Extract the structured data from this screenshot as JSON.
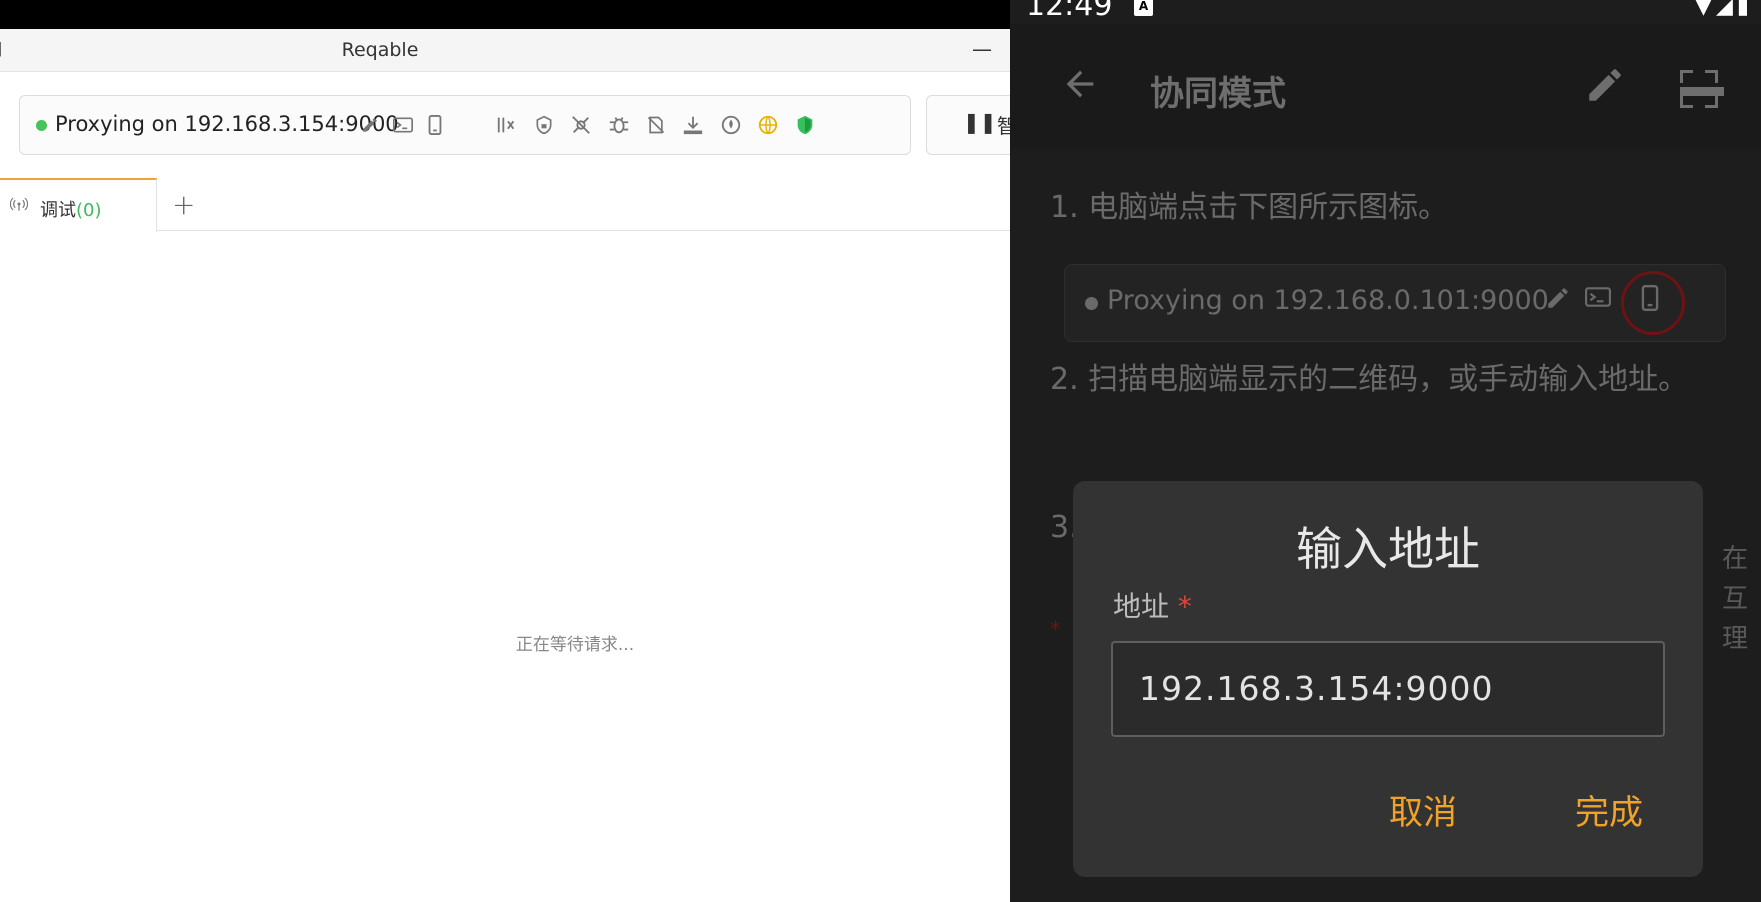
{
  "desktop": {
    "window_title": "Reqable",
    "minimize_glyph": "—",
    "edge_glyph": "]",
    "proxy_status": "Proxying on 192.168.3.154:9000",
    "toolbar_icons": [
      "edit-icon",
      "terminal-icon",
      "mobile-icon",
      "breakpoint-icon",
      "ssl-lock-icon",
      "no-capture-icon",
      "debug-icon",
      "rewrite-off-icon",
      "download-icon",
      "script-icon",
      "proxy-globe-icon",
      "shield-icon"
    ],
    "pause_label": "智",
    "tab": {
      "label": "调试",
      "count": "(0)"
    },
    "add_tab": "+",
    "waiting_text": "正在等待请求..."
  },
  "phone": {
    "status_time": "12:49",
    "status_a_icon": "A",
    "title": "协同模式",
    "steps": {
      "step1": "1. 电脑端点击下图所示图标。",
      "step2": "2. 扫描电脑端显示的二维码，或手动输入地址。",
      "step3": "3.",
      "mini_proxy": "Proxying on 192.168.0.101:9000"
    },
    "red_star": "*",
    "edge_chars": [
      "在",
      "互",
      "理"
    ],
    "dialog": {
      "title": "输入地址",
      "field_label": "地址",
      "required_mark": "*",
      "value": "192.168.3.154:9000",
      "cancel": "取消",
      "done": "完成"
    }
  },
  "colors": {
    "accent_orange": "#f0a328",
    "proxy_green": "#45c45a",
    "required_red": "#e0453c",
    "phone_bg": "#1d1d1d",
    "dialog_bg": "#333333"
  }
}
